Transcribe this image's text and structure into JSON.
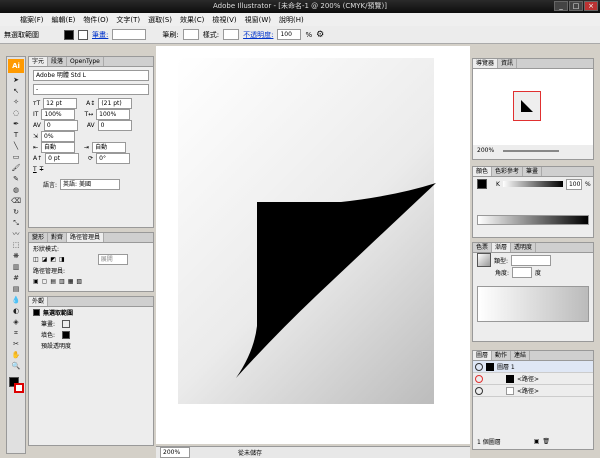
{
  "window": {
    "title": "Adobe Illustrator - [未命名-1 @ 200% (CMYK/預覽)]",
    "min": "_",
    "max": "□",
    "close": "×"
  },
  "menu": [
    "檔案(F)",
    "編輯(E)",
    "物件(O)",
    "文字(T)",
    "選取(S)",
    "效果(C)",
    "檢視(V)",
    "視窗(W)",
    "說明(H)"
  ],
  "control": {
    "selection": "無選取範圍",
    "stroke_link": "筆畫:",
    "brush": "筆刷:",
    "style": "樣式:",
    "opacity_link": "不透明度:",
    "opacity": "100",
    "percent": "%"
  },
  "colors": {
    "accent": "#ff9a00",
    "highlight_red": "#e03030"
  },
  "character": {
    "tabs": [
      "字元",
      "段落",
      "OpenType"
    ],
    "font": "Adobe 明體 Std L",
    "font_style": "-",
    "size": "12 pt",
    "leading": "(21 pt)",
    "hscale": "100%",
    "vscale": "100%",
    "kern": "0",
    "track": "0",
    "tsume": "0%",
    "aki_l": "自動",
    "aki_r": "自動",
    "baseline": "0 pt",
    "rotate": "0°",
    "language_label": "語言:",
    "language": "英語: 美國"
  },
  "pathfinder": {
    "tabs": [
      "變形",
      "對齊",
      "路徑管理員"
    ],
    "shape_modes": "形狀模式:",
    "expand": "展開",
    "pathfinders": "路徑管理員:"
  },
  "appearance": {
    "tabs": [
      "外觀"
    ],
    "header": "無選取範圍",
    "stroke_label": "筆畫:",
    "fill_label": "填色:",
    "opacity_label": "預設透明度"
  },
  "navigator": {
    "tabs": [
      "導覽器",
      "資訊"
    ],
    "zoom": "200%"
  },
  "color_panel": {
    "tabs": [
      "顏色",
      "色彩參考",
      "筆畫"
    ],
    "channel": "K",
    "value": "100",
    "percent": "%"
  },
  "gradient": {
    "tabs": [
      "色票",
      "漸層",
      "透明度"
    ],
    "type_label": "類型:",
    "angle_label": "角度:",
    "angle_unit": "度"
  },
  "layers": {
    "tabs": [
      "圖層",
      "動作",
      "連結"
    ],
    "layer_name": "圖層 1",
    "paths": [
      "<路徑>",
      "<路徑>"
    ],
    "count": "1 個圖層"
  },
  "status": {
    "zoom": "200%",
    "state": "從未儲存"
  }
}
